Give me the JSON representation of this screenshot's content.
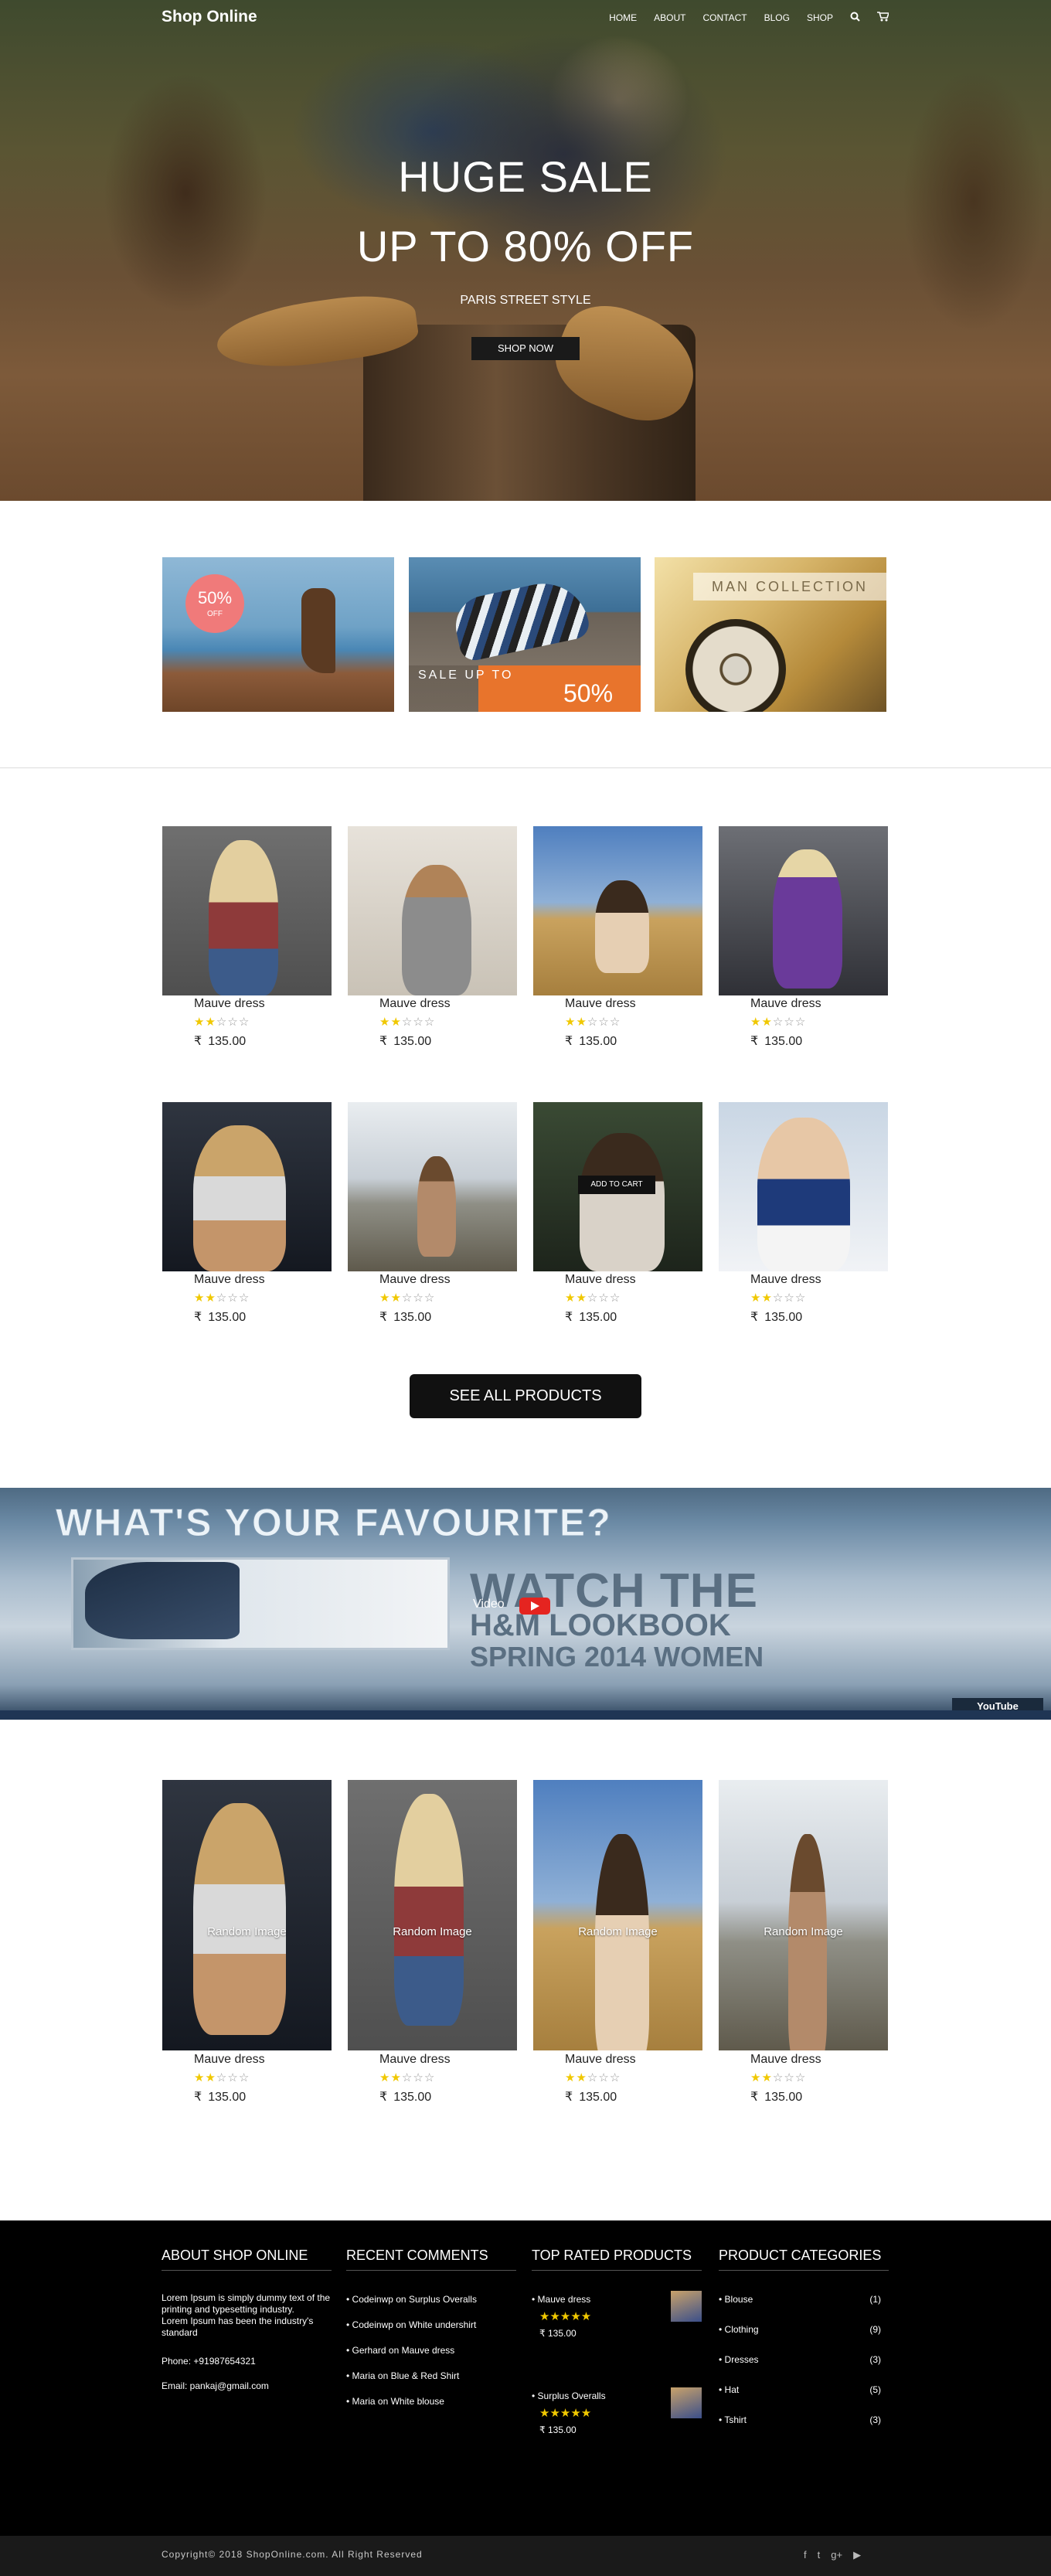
{
  "nav": {
    "brand": "Shop Online",
    "links": [
      "HOME",
      "ABOUT",
      "CONTACT",
      "BLOG",
      "SHOP"
    ],
    "icons": [
      "search-icon",
      "cart-icon"
    ]
  },
  "hero": {
    "line1": "HUGE SALE",
    "line2": "UP TO 80% OFF",
    "subtitle": "PARIS STREET STYLE",
    "button": "SHOP NOW"
  },
  "promos": {
    "p1_pct": "50%",
    "p1_off": "OFF",
    "p2_sale": "SALE UP TO",
    "p2_pct": "50%",
    "p3_label": "MAN COLLECTION"
  },
  "products": [
    {
      "title": "Mauve dress",
      "rating": 2,
      "currency": "₹",
      "price": "135.00"
    },
    {
      "title": "Mauve dress",
      "rating": 2,
      "currency": "₹",
      "price": "135.00"
    },
    {
      "title": "Mauve dress",
      "rating": 2,
      "currency": "₹",
      "price": "135.00"
    },
    {
      "title": "Mauve dress",
      "rating": 2,
      "currency": "₹",
      "price": "135.00"
    },
    {
      "title": "Mauve dress",
      "rating": 2,
      "currency": "₹",
      "price": "135.00"
    },
    {
      "title": "Mauve dress",
      "rating": 2,
      "currency": "₹",
      "price": "135.00"
    },
    {
      "title": "Mauve dress",
      "rating": 2,
      "currency": "₹",
      "price": "135.00",
      "add_to_cart": "ADD TO CART"
    },
    {
      "title": "Mauve dress",
      "rating": 2,
      "currency": "₹",
      "price": "135.00"
    }
  ],
  "see_all": "SEE ALL PRODUCTS",
  "video": {
    "headline": "WHAT'S YOUR  FAVOURITE?",
    "watch_line1": "WATCH THE",
    "watch_line2": "H&M LOOKBOOK",
    "watch_line3": "SPRING 2014 WOMEN",
    "label": "Video",
    "youtube": "YouTube"
  },
  "random_products": [
    {
      "overlay": "Random Image",
      "title": "Mauve dress",
      "rating": 2,
      "currency": "₹",
      "price": "135.00"
    },
    {
      "overlay": "Random Image",
      "title": "Mauve dress",
      "rating": 2,
      "currency": "₹",
      "price": "135.00"
    },
    {
      "overlay": "Random Image",
      "title": "Mauve dress",
      "rating": 2,
      "currency": "₹",
      "price": "135.00"
    },
    {
      "overlay": "Random Image",
      "title": "Mauve dress",
      "rating": 2,
      "currency": "₹",
      "price": "135.00"
    }
  ],
  "footer": {
    "about": {
      "heading": "ABOUT SHOP ONLINE",
      "text1": "Lorem Ipsum is simply dummy text of the printing and typesetting industry.",
      "text2": "Lorem Ipsum has been the industry's standard",
      "phone": "Phone: +91987654321",
      "email": "Email: pankaj@gmail.com"
    },
    "comments": {
      "heading": "RECENT COMMENTS",
      "items": [
        {
          "author": "Codeinwp",
          "on": " on ",
          "target": "Surplus Overalls"
        },
        {
          "author": "Codeinwp",
          "on": " on ",
          "target": "White undershirt"
        },
        {
          "author": "Gerhard",
          "on": " on ",
          "target": "Mauve dress"
        },
        {
          "author": "Maria",
          "on": " on ",
          "target": "Blue & Red Shirt"
        },
        {
          "author": "Maria",
          "on": " on ",
          "target": "White blouse"
        }
      ]
    },
    "top_rated": {
      "heading": "TOP RATED PRODUCTS",
      "items": [
        {
          "name": "Mauve dress",
          "stars": "★★★★★",
          "price": "₹ 135.00"
        },
        {
          "name": "Surplus Overalls",
          "stars": "★★★★★",
          "price": "₹ 135.00"
        }
      ]
    },
    "categories": {
      "heading": "PRODUCT CATEGORIES",
      "items": [
        {
          "name": "Blouse",
          "count": "(1)"
        },
        {
          "name": "Clothing",
          "count": "(9)"
        },
        {
          "name": "Dresses",
          "count": "(3)"
        },
        {
          "name": "Hat",
          "count": "(5)"
        },
        {
          "name": "Tshirt",
          "count": "(3)"
        }
      ]
    },
    "copyright": "Copyright© 2018 ShopOnline.com. All Right Reserved",
    "social": [
      "facebook-icon",
      "twitter-icon",
      "google-plus-icon",
      "youtube-icon"
    ]
  },
  "colors": {
    "star": "#f0c800",
    "dark": "#111111",
    "promo_pink": "#f07a7a",
    "promo_orange": "#e8742c",
    "youtube_red": "#e52420"
  }
}
